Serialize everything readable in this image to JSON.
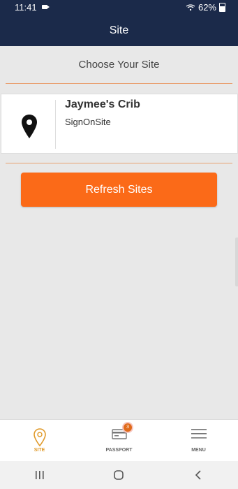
{
  "status": {
    "time": "11:41",
    "battery": "62%"
  },
  "appbar": {
    "title": "Site"
  },
  "header": {
    "choose": "Choose Your Site"
  },
  "site": {
    "name": "Jaymee's Crib",
    "org": "SignOnSite"
  },
  "actions": {
    "refresh_label": "Refresh Sites"
  },
  "nav": {
    "site_label": "SITE",
    "passport_label": "PASSPORT",
    "passport_badge": "3",
    "menu_label": "MENU"
  },
  "colors": {
    "accent": "#fb6a18",
    "appbar": "#1b2a4a"
  }
}
